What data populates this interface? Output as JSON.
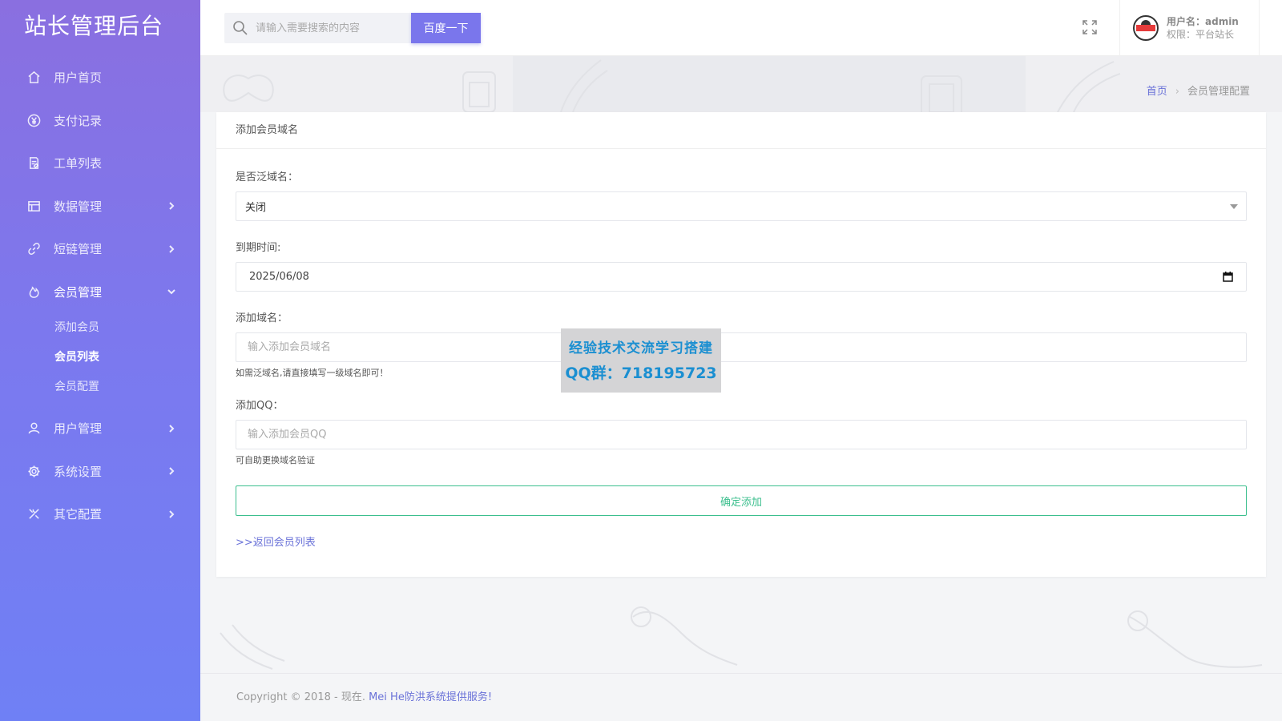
{
  "sidebar": {
    "brand": "站长管理后台",
    "items": [
      {
        "label": "用户首页",
        "icon": "home-icon"
      },
      {
        "label": "支付记录",
        "icon": "yen-icon"
      },
      {
        "label": "工单列表",
        "icon": "ticket-icon"
      },
      {
        "label": "数据管理",
        "icon": "database-icon"
      },
      {
        "label": "短链管理",
        "icon": "link-icon"
      },
      {
        "label": "会员管理",
        "icon": "fire-icon",
        "expanded": true,
        "children": [
          {
            "label": "添加会员"
          },
          {
            "label": "会员列表",
            "current": true
          },
          {
            "label": "会员配置"
          }
        ]
      },
      {
        "label": "用户管理",
        "icon": "user-icon"
      },
      {
        "label": "系统设置",
        "icon": "gear-icon"
      },
      {
        "label": "其它配置",
        "icon": "tools-icon"
      }
    ]
  },
  "header": {
    "search_placeholder": "请输入需要搜索的内容",
    "search_button": "百度一下",
    "user_name_label": "用户名：admin",
    "user_role_label": "权限：平台站长"
  },
  "breadcrumb": {
    "home": "首页",
    "current": "会员管理配置"
  },
  "form": {
    "title": "添加会员域名",
    "wildcard_label": "是否泛域名：",
    "wildcard_value": "关闭",
    "expire_label": "到期时间:",
    "expire_value": "2025/06/08",
    "domain_label": "添加域名：",
    "domain_placeholder": "输入添加会员域名",
    "domain_help": "如需泛域名,请直接填写一级域名即可！",
    "qq_label": "添加QQ：",
    "qq_placeholder": "输入添加会员QQ",
    "qq_help": "可自助更换域名验证",
    "submit_label": "确定添加",
    "back_link": ">>返回会员列表"
  },
  "watermark": {
    "line1": "经验技术交流学习搭建",
    "line2": "QQ群：718195723"
  },
  "footer": {
    "copyright": "Copyright © 2018 - 现在. ",
    "brand": "Mei He防洪系统提供服务!"
  },
  "colors": {
    "sidebar_top": "#8a6fe0",
    "sidebar_bottom": "#6f80f5",
    "accent": "#7a76ec",
    "success": "#3cbf8e",
    "link": "#6a72d8"
  }
}
